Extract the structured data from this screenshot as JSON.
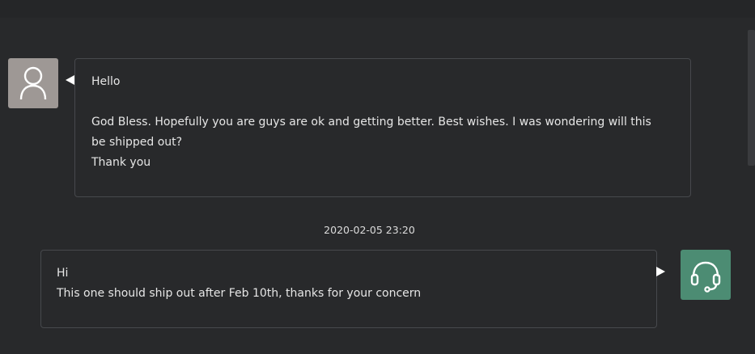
{
  "conversation": {
    "messages": [
      {
        "sender": "customer",
        "avatar_icon": "user-outline-icon",
        "lines": [
          "Hello",
          "",
          "God Bless. Hopefully you are guys are ok and getting better. Best wishes. I was wondering will this",
          "be shipped out?",
          "Thank you"
        ]
      },
      {
        "sender": "support",
        "timestamp": "2020-02-05 23:20",
        "avatar_icon": "headset-icon",
        "lines": [
          "Hi",
          "This one should ship out after Feb 10th, thanks for your concern"
        ]
      }
    ]
  },
  "colors": {
    "background": "#28292b",
    "bubble_border": "#47494d",
    "customer_avatar": "#9e9895",
    "support_avatar": "#4c8c73",
    "text": "#e6e6e6"
  }
}
